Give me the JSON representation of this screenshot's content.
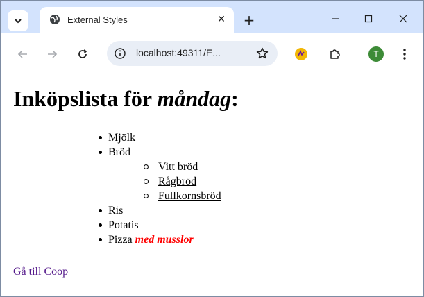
{
  "browser": {
    "tab_title": "External Styles",
    "tab_close": "✕",
    "new_tab": "+",
    "url": "localhost:49311/E...",
    "profile_initial": "T",
    "colors": {
      "tabstrip": "#d3e3fd",
      "omnibox": "#e9eef6",
      "avatar": "#3d8b37"
    }
  },
  "page": {
    "heading_prefix": "Inköpslista för ",
    "heading_day": "måndag",
    "heading_suffix": ":",
    "items": [
      {
        "label": "Mjölk"
      },
      {
        "label": "Bröd",
        "subitems": [
          "Vitt bröd",
          "Rågbröd",
          "Fullkornsbröd"
        ]
      },
      {
        "label": "Ris"
      },
      {
        "label": "Potatis"
      },
      {
        "label": "Pizza ",
        "highlight": "med musslor"
      }
    ],
    "link_label": "Gå till Coop",
    "colors": {
      "highlight": "#ff0000",
      "visited_link": "#551a8b"
    }
  }
}
